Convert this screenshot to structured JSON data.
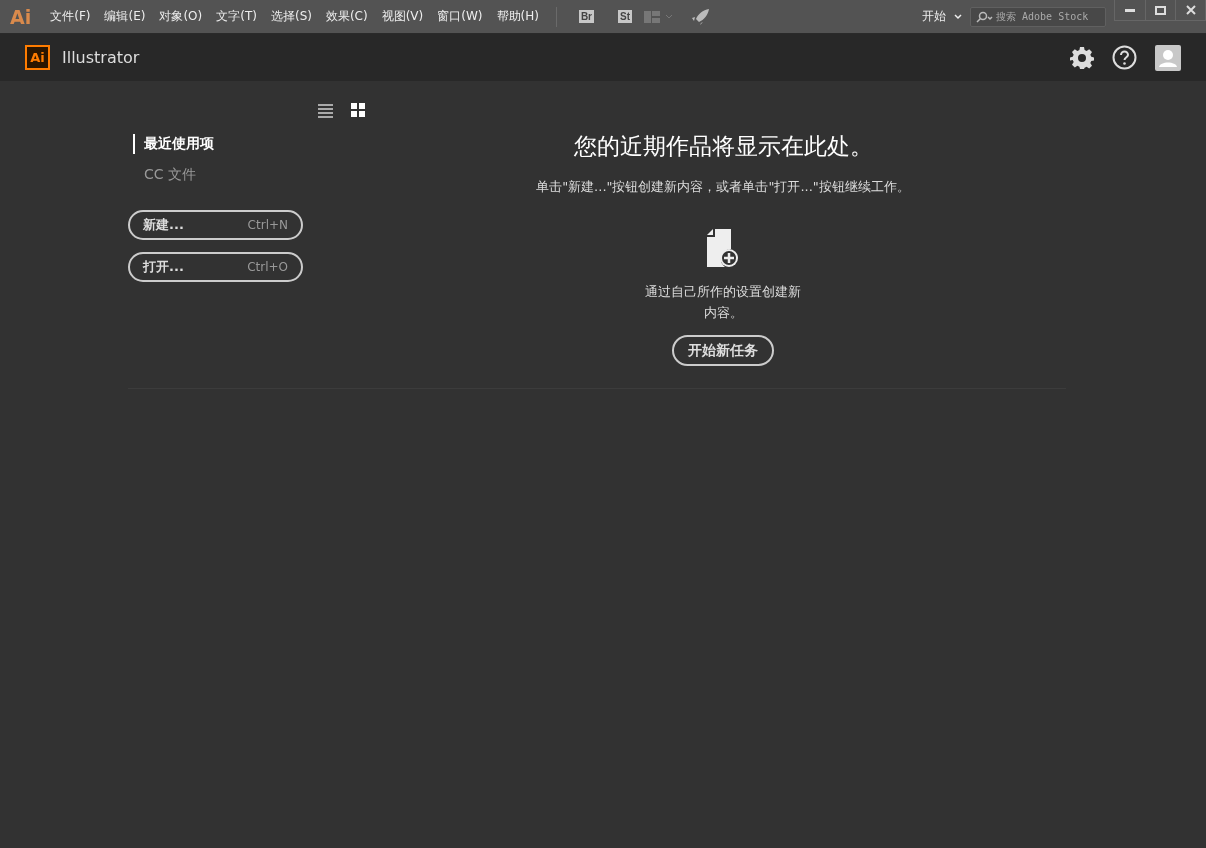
{
  "app_logo": "Ai",
  "menu": [
    "文件(F)",
    "编辑(E)",
    "对象(O)",
    "文字(T)",
    "选择(S)",
    "效果(C)",
    "视图(V)",
    "窗口(W)",
    "帮助(H)"
  ],
  "app_buttons": [
    "Br",
    "St"
  ],
  "workspace": "开始",
  "search": {
    "placeholder": "搜索 Adobe Stock"
  },
  "header": {
    "logo": "Ai",
    "title": "Illustrator"
  },
  "view_toggles": [
    {
      "kind": "list",
      "selected": false
    },
    {
      "kind": "grid",
      "selected": true
    }
  ],
  "sidebar": {
    "items": [
      {
        "label": "最近使用项",
        "selected": true
      },
      {
        "label": "CC 文件",
        "selected": false
      }
    ],
    "buttons": [
      {
        "label": "新建...",
        "shortcut": "Ctrl+N"
      },
      {
        "label": "打开...",
        "shortcut": "Ctrl+O"
      }
    ]
  },
  "main": {
    "title": "您的近期作品将显示在此处。",
    "subtitle": "单击\"新建...\"按钮创建新内容，或者单击\"打开...\"按钮继续工作。",
    "hint": "通过自己所作的设置创建新内容。",
    "button": "开始新任务"
  }
}
